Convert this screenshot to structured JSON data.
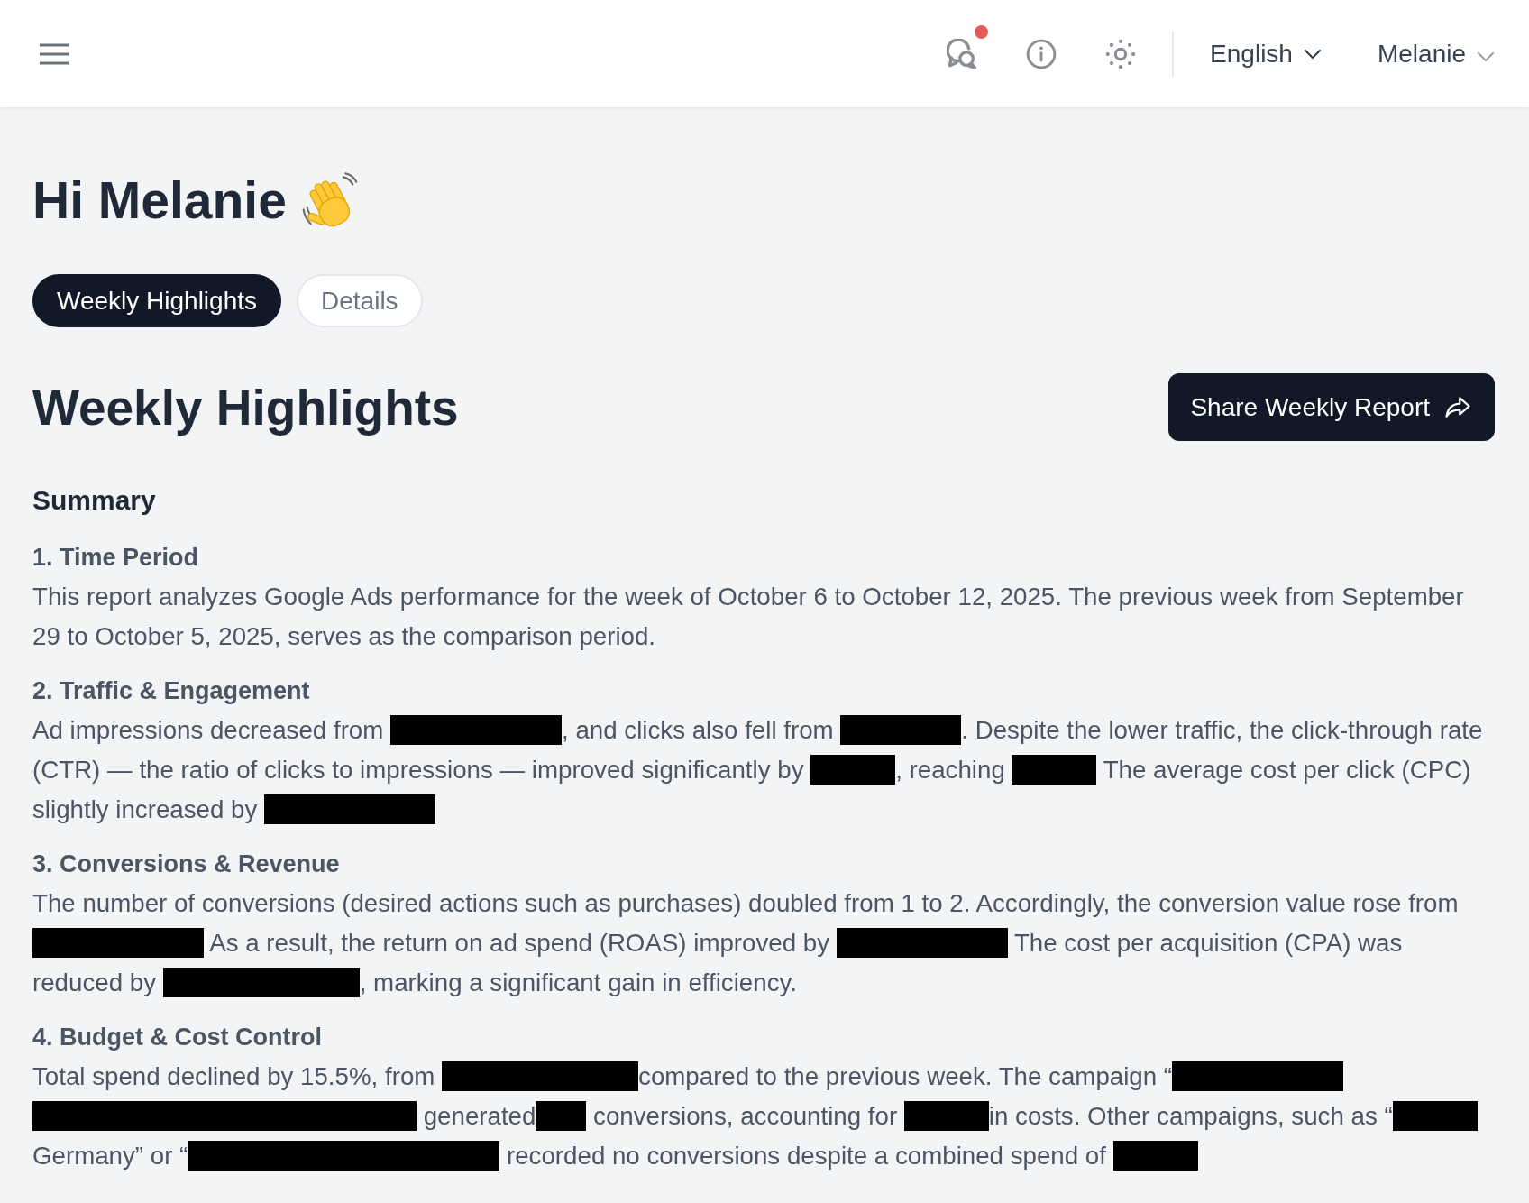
{
  "header": {
    "notifications": {
      "unread": true
    },
    "language": "English",
    "user": "Melanie"
  },
  "greeting": "Hi Melanie",
  "tabs": [
    {
      "label": "Weekly Highlights",
      "selected": true
    },
    {
      "label": "Details",
      "selected": false
    }
  ],
  "section": {
    "title": "Weekly Highlights",
    "share_button": "Share Weekly Report"
  },
  "summary": {
    "title": "Summary",
    "items": [
      {
        "heading": "1. Time Period",
        "lines": [
          {
            "segments": [
              {
                "kind": "text",
                "text": "This report analyzes Google Ads performance for the week of October 6 to October 12, 2025. The previous week from September 29 to October 5, 2025, serves as the comparison period."
              }
            ]
          }
        ]
      },
      {
        "heading": "2. Traffic & Engagement",
        "lines": [
          {
            "segments": [
              {
                "kind": "text",
                "text": "Ad impressions decreased from "
              },
              {
                "kind": "longbar"
              },
              {
                "kind": "text",
                "text": ", and clicks also fell from "
              },
              {
                "kind": "mediumbar"
              },
              {
                "kind": "text",
                "text": ". Despite the lower traffic, the click-through rate"
              }
            ]
          },
          {
            "segments": [
              {
                "kind": "text",
                "text": "(CTR) — the ratio of clicks to impressions — improved significantly by "
              },
              {
                "kind": "shortbar"
              },
              {
                "kind": "text",
                "text": ", reaching "
              },
              {
                "kind": "shortbar"
              },
              {
                "kind": "text",
                "text": " The average cost per click (CPC)"
              }
            ]
          },
          {
            "segments": [
              {
                "kind": "text",
                "text": "slightly increased by "
              },
              {
                "kind": "longbar"
              }
            ]
          }
        ]
      },
      {
        "heading": "3. Conversions & Revenue",
        "lines": [
          {
            "segments": [
              {
                "kind": "text",
                "text": "The number of conversions (desired actions such as purchases) doubled from 1 to 2. Accordingly, the conversion value rose from"
              }
            ]
          },
          {
            "segments": [
              {
                "kind": "longbar"
              },
              {
                "kind": "text",
                "text": " As a result, the return on ad spend (ROAS) improved by "
              },
              {
                "kind": "longbar"
              },
              {
                "kind": "text",
                "text": " The cost per acquisition (CPA) was"
              }
            ]
          },
          {
            "segments": [
              {
                "kind": "text",
                "text": "reduced by "
              },
              {
                "kind": "longerbar"
              },
              {
                "kind": "text",
                "text": ", marking a significant gain in efficiency."
              }
            ]
          }
        ]
      },
      {
        "heading": "4. Budget & Cost Control",
        "lines": [
          {
            "segments": [
              {
                "kind": "text",
                "text": "Total spend declined by 15.5%, from "
              },
              {
                "kind": "longerbar"
              },
              {
                "kind": "text",
                "text": "compared to the previous week. The campaign “"
              },
              {
                "kind": "longbar"
              }
            ]
          },
          {
            "segments": [
              {
                "kind": "widestbar"
              },
              {
                "kind": "text",
                "text": " generated"
              },
              {
                "kind": "tinybar"
              },
              {
                "kind": "text",
                "text": " conversions, accounting for "
              },
              {
                "kind": "shortbar"
              },
              {
                "kind": "text",
                "text": "in costs. Other campaigns, such as “"
              },
              {
                "kind": "shortbar"
              }
            ]
          },
          {
            "segments": [
              {
                "kind": "text",
                "text": "Germany” or “"
              },
              {
                "kind": "widebar"
              },
              {
                "kind": "text",
                "text": " recorded no conversions despite a combined spend of "
              },
              {
                "kind": "shortbar"
              }
            ]
          }
        ]
      }
    ]
  }
}
